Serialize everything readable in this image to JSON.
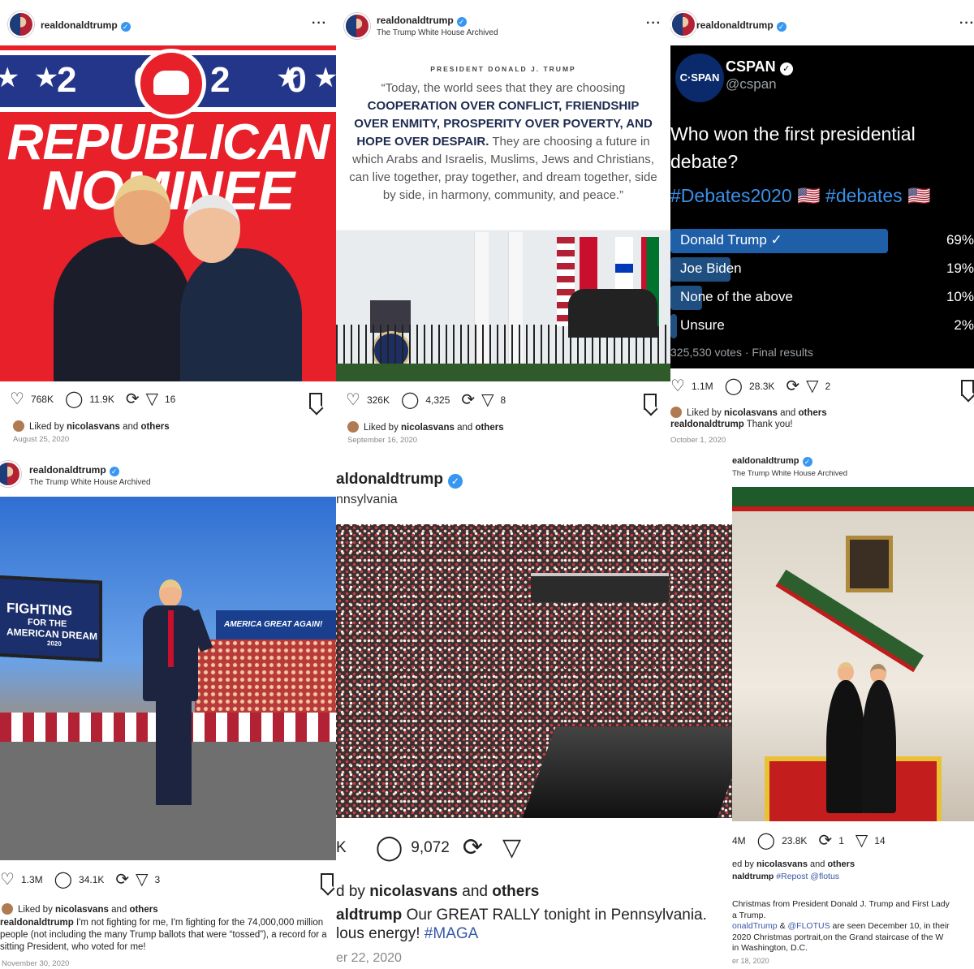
{
  "posts": [
    {
      "username": "realdonaldtrump",
      "subtitle": "",
      "artwork": {
        "year_text": "2020",
        "line1": "REPUBLICAN",
        "line2": "NOMINEE"
      },
      "likes": "768K",
      "comments": "11.9K",
      "shares": "16",
      "liked_by_user": "nicolasvans",
      "liked_by_others": "others",
      "date": "August 25, 2020",
      "caption_user": "",
      "caption_text": ""
    },
    {
      "username": "realdonaldtrump",
      "subtitle": "The Trump White House Archived",
      "artwork": {
        "title": "PRESIDENT DONALD J. TRUMP",
        "quote_lead": "“Today, the world sees that they are choosing",
        "quote_bold": "COOPERATION OVER CONFLICT, FRIENDSHIP OVER ENMITY, PROSPERITY OVER POVERTY, AND HOPE OVER DESPAIR.",
        "quote_tail": "They are choosing a future in which Arabs and Israelis, Muslims, Jews and Christians, can live together, pray together, and dream together, side by side, in harmony, community, and peace.”"
      },
      "likes": "326K",
      "comments": "4,325",
      "shares": "8",
      "liked_by_user": "nicolasvans",
      "liked_by_others": "others",
      "date": "September 16, 2020"
    },
    {
      "username": "realdonaldtrump",
      "subtitle": "",
      "artwork": {
        "account_name": "CSPAN",
        "account_handle": "@cspan",
        "logo_text": "C·SPAN",
        "question": "Who won the first presidential debate?",
        "hashtags": "#Debates2020 🇺🇸 #debates 🇺🇸",
        "options": [
          {
            "label": "Donald Trump",
            "percent": "69%",
            "share": 0.69
          },
          {
            "label": "Joe Biden",
            "percent": "19%",
            "share": 0.19
          },
          {
            "label": "None of the above",
            "percent": "10%",
            "share": 0.1
          },
          {
            "label": "Unsure",
            "percent": "2%",
            "share": 0.02
          }
        ],
        "footer": "325,530 votes · Final results"
      },
      "likes": "1.1M",
      "comments": "28.3K",
      "shares": "2",
      "liked_by_user": "nicolasvans",
      "liked_by_others": "others",
      "caption_user": "realdonaldtrump",
      "caption_text": "Thank you!",
      "date": "October 1, 2020"
    },
    {
      "username": "realdonaldtrump",
      "subtitle": "The Trump White House Archived",
      "artwork": {
        "screen_line1": "FIGHTING",
        "screen_line2": "FOR THE",
        "screen_line3": "AMERICAN DREAM",
        "screen_year": "2020",
        "banner_text": "AMERICA GREAT AGAIN!"
      },
      "likes": "1.3M",
      "comments": "34.1K",
      "shares": "3",
      "liked_by_user": "nicolasvans",
      "liked_by_others": "others",
      "caption_user": "realdonaldtrump",
      "caption_text": "I'm not fighting for me, I'm fighting for the 74,000,000 million people (not including the many Trump ballots that were “tossed”), a record for a sitting President, who voted for me!",
      "date": "November 30, 2020"
    },
    {
      "username": "aldonaldtrump",
      "subtitle": "nnsylvania",
      "likes": "K",
      "comments": "9,072",
      "liked_by_prefix": "d by",
      "liked_by_user": "nicolasvans",
      "liked_by_others": "others",
      "caption_user": "aldtrump",
      "caption_text": "Our GREAT RALLY tonight in Pennsylvania.",
      "caption_line2": "lous energy!",
      "caption_hashtag": "#MAGA",
      "date": "er 22, 2020"
    },
    {
      "username": "ealdonaldtrump",
      "subtitle": "The Trump White House Archived",
      "likes": "4M",
      "comments": "23.8K",
      "reposts": "1",
      "shares": "14",
      "liked_by_prefix": "ed by",
      "liked_by_user": "nicolasvans",
      "liked_by_others": "others",
      "caption_user": "naldtrump",
      "caption_text": "#Repost @flotus",
      "caption_line2": "Christmas from President Donald J. Trump and First Lady",
      "caption_line3": "a Trump.",
      "caption_line4_tag1": "onaldTrump",
      "caption_line4_amp": "&",
      "caption_line4_tag2": "@FLOTUS",
      "caption_line4_text": "are seen December 10, in their",
      "caption_line5": "2020 Christmas portrait,on the Grand staircase of the W",
      "caption_line6": "in Washington, D.C.",
      "date": "er 18, 2020"
    }
  ],
  "icons": {
    "like": "heart-icon",
    "comment": "comment-icon",
    "repost": "repost-icon",
    "share": "send-icon",
    "save": "bookmark-icon",
    "more": "more-icon"
  },
  "colors": {
    "verified": "#3797f0",
    "link": "#3658a6",
    "cspan_bar": "#1f4f80"
  }
}
